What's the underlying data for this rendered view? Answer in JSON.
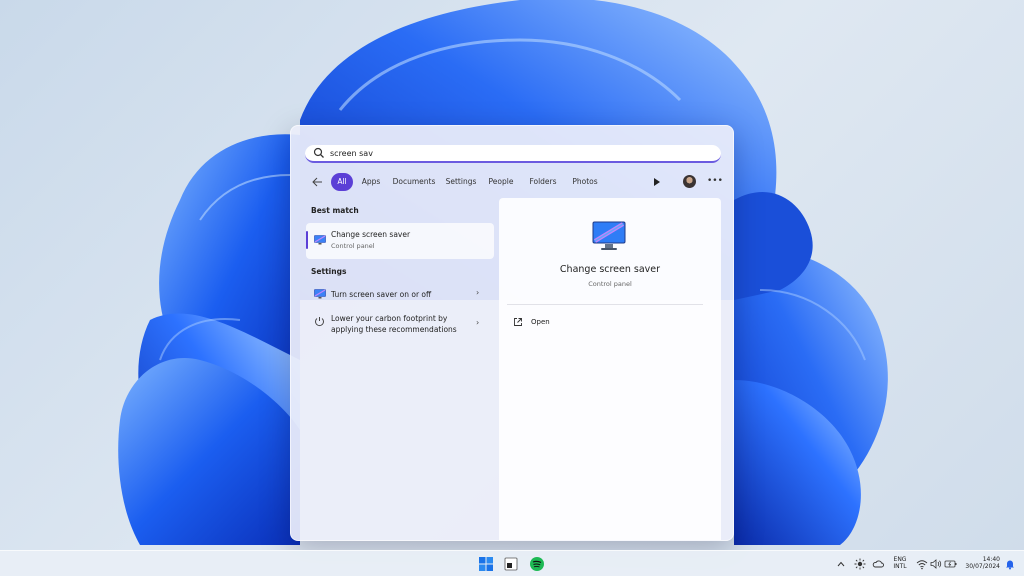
{
  "search": {
    "query": "screen sav"
  },
  "filters": [
    {
      "label": "All",
      "active": true
    },
    {
      "label": "Apps"
    },
    {
      "label": "Documents"
    },
    {
      "label": "Settings"
    },
    {
      "label": "People"
    },
    {
      "label": "Folders"
    },
    {
      "label": "Photos"
    }
  ],
  "results": {
    "best_match_header": "Best match",
    "best_match": {
      "title": "Change screen saver",
      "subtitle": "Control panel"
    },
    "settings_header": "Settings",
    "settings_items": [
      {
        "title": "Turn screen saver on or off"
      },
      {
        "title_line1": "Lower your carbon footprint by",
        "title_line2": "applying these recommendations"
      }
    ]
  },
  "detail": {
    "title": "Change screen saver",
    "subtitle": "Control panel",
    "action_open": "Open"
  },
  "tray": {
    "lang_line1": "ENG",
    "lang_line2": "INTL",
    "time": "14:40",
    "date": "30/07/2024"
  },
  "colors": {
    "accent": "#5b3fd6",
    "wallpaper_blue": "#1a56e8"
  },
  "icons": [
    "search-icon",
    "back-arrow-icon",
    "play-icon",
    "more-icon",
    "monitor-icon",
    "leaf-icon",
    "open-external-icon",
    "windows-start-icon",
    "file-explorer-icon",
    "spotify-icon",
    "chevron-up-icon",
    "brightness-icon",
    "cloud-icon",
    "wifi-icon",
    "volume-icon",
    "battery-icon",
    "notification-bell-icon"
  ]
}
